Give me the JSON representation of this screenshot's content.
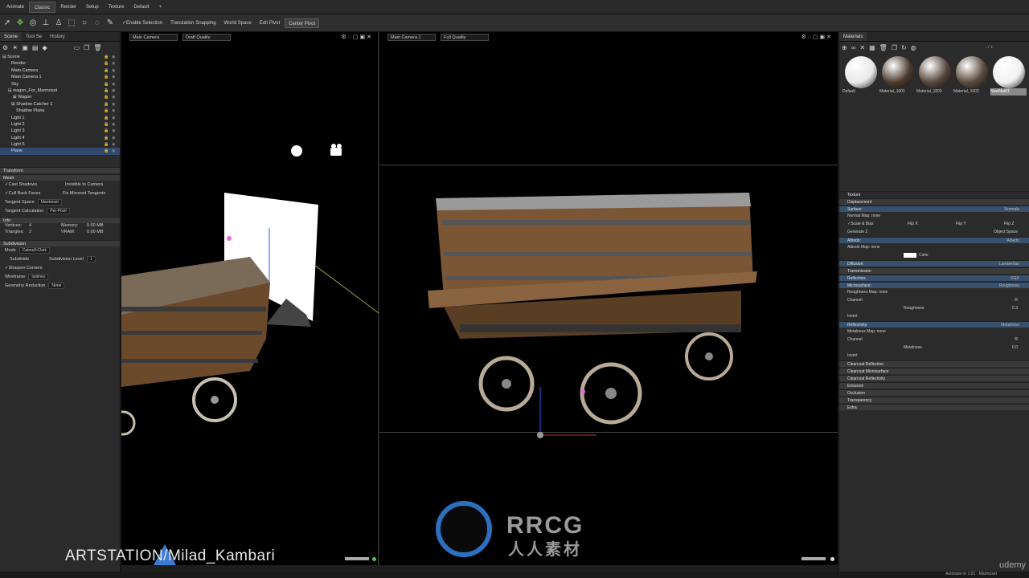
{
  "menubar": {
    "items": [
      "Animate",
      "Classic",
      "Render",
      "Setup",
      "Texture",
      "Default",
      "+"
    ]
  },
  "toolbar": {
    "tools": [
      "select-icon",
      "move-icon",
      "rotate-icon",
      "scale-icon",
      "person-icon",
      "marquee-icon",
      "circle-select-icon",
      "lasso-icon",
      "paint-icon"
    ],
    "buttons": [
      "✓Enable Selection",
      "Translation Snapping",
      "World Space",
      "Edit Pivot",
      "Center Pivot"
    ]
  },
  "left": {
    "tabs": [
      "Scene",
      "Tool Se",
      "History"
    ],
    "tree": [
      "⊟ Scene",
      "Render",
      "Main Camera",
      "Main Camera 1",
      "Sky",
      "⊟ wagon_For_Marmoset",
      "⊞ Wagon",
      "⊞ Shadow Catcher 1",
      "Shadow Plane",
      "Light 1",
      "Light 2",
      "Light 3",
      "Light 4",
      "Light 5",
      "Plane"
    ],
    "transform": "Transform",
    "mesh": "Mesh",
    "cast_shadows": "✓Cast Shadows",
    "invisible": "Invisible to Camera",
    "cull": "✓Cull Back Faces",
    "fix_tangents": "Fix Mirrored Tangents",
    "tangent_space_label": "Tangent Space",
    "tangent_space_val": "Marmoset",
    "tangent_calc_label": "Tangent Calculation",
    "tangent_calc_val": "Per-Pixel",
    "info": "Info",
    "vertices_label": "Vertices:",
    "vertices_val": "4",
    "memory_label": "Memory:",
    "memory_val": "0.00 MB",
    "triangles_label": "Triangles:",
    "triangles_val": "2",
    "vram_label": "VRAM:",
    "vram_val": "0.00 MB",
    "subdivision": "Subdivision",
    "mode_label": "Mode",
    "mode_val": "Catmull-Clark",
    "subdivide": "Subdivide",
    "subdiv_level_label": "Subdivision Level",
    "subdiv_level_val": "1",
    "sharpen": "✓Sharpen Corners",
    "wireframe_label": "Wireframe",
    "wireframe_val": "Isolines",
    "georeduce_label": "Geometry Reduction",
    "georeduce_val": "None"
  },
  "viewport1": {
    "camera": "Main Camera",
    "quality": "Draft Quality"
  },
  "viewport2": {
    "camera": "Main Camera 1",
    "quality": "Full Quality"
  },
  "right": {
    "tab": "Materials",
    "path": "- / +",
    "materials": [
      {
        "name": "Default",
        "color": "#e8e8e8"
      },
      {
        "name": "Material_1001",
        "color": "#4a3a2c"
      },
      {
        "name": "Material_1002",
        "color": "#55453a"
      },
      {
        "name": "Material_1003",
        "color": "#5a4a3c"
      },
      {
        "name": "NewMat01",
        "color": "#f0f0f0"
      }
    ],
    "sections": [
      {
        "label": "Texture",
        "type": "head"
      },
      {
        "label": "Displacement",
        "type": "sub",
        "value": ""
      },
      {
        "label": "Surface:",
        "type": "blue",
        "value": "Normals"
      },
      {
        "label": "Normal Map: none",
        "type": "row"
      },
      {
        "label": "✓Scale & Bias",
        "type": "row",
        "extra": [
          "Flip X",
          "Flip Y",
          "Flip Z"
        ]
      },
      {
        "label": "Generate Z",
        "type": "row",
        "value": "Object Space"
      },
      {
        "label": "Albedo:",
        "type": "blue",
        "value": "Albedo"
      },
      {
        "label": "Albedo Map: none",
        "type": "row"
      },
      {
        "label": "Color",
        "type": "color"
      },
      {
        "label": "Diffusion:",
        "type": "blue",
        "value": "Lambertian"
      },
      {
        "label": "Transmission",
        "type": "sub",
        "value": ""
      },
      {
        "label": "Reflection:",
        "type": "blue",
        "value": "GGX"
      },
      {
        "label": "Microsurface:",
        "type": "blue",
        "value": "Roughness"
      },
      {
        "label": "Roughness Map: none",
        "type": "row"
      },
      {
        "label": "Channel",
        "type": "row",
        "value": "R"
      },
      {
        "label": "Roughness",
        "type": "slider",
        "value": "0.3"
      },
      {
        "label": "Invert",
        "type": "row"
      },
      {
        "label": "Reflectivity:",
        "type": "blue",
        "value": "Metalness"
      },
      {
        "label": "Metalness Map: none",
        "type": "row"
      },
      {
        "label": "Channel",
        "type": "row",
        "value": "R"
      },
      {
        "label": "Metalness",
        "type": "slider",
        "value": "0.0"
      },
      {
        "label": "Invert",
        "type": "row"
      },
      {
        "label": "Clearcoat Reflection",
        "type": "sub",
        "value": ""
      },
      {
        "label": "Clearcoat Microsurface",
        "type": "sub",
        "value": ""
      },
      {
        "label": "Clearcoat Reflectivity",
        "type": "sub",
        "value": ""
      },
      {
        "label": "Emission",
        "type": "sub",
        "value": ""
      },
      {
        "label": "Occlusion",
        "type": "sub",
        "value": ""
      },
      {
        "label": "Transparency",
        "type": "sub",
        "value": ""
      },
      {
        "label": "Extra",
        "type": "sub",
        "value": ""
      }
    ]
  },
  "watermark": {
    "artstation": "ARTSTATION/Milad_Kambari",
    "rrcg": "RRCG",
    "rrcg_cn": "人人素材",
    "udemy": "udemy"
  },
  "status": {
    "autosave": "Autosave in 1:21 · Marmoset"
  }
}
